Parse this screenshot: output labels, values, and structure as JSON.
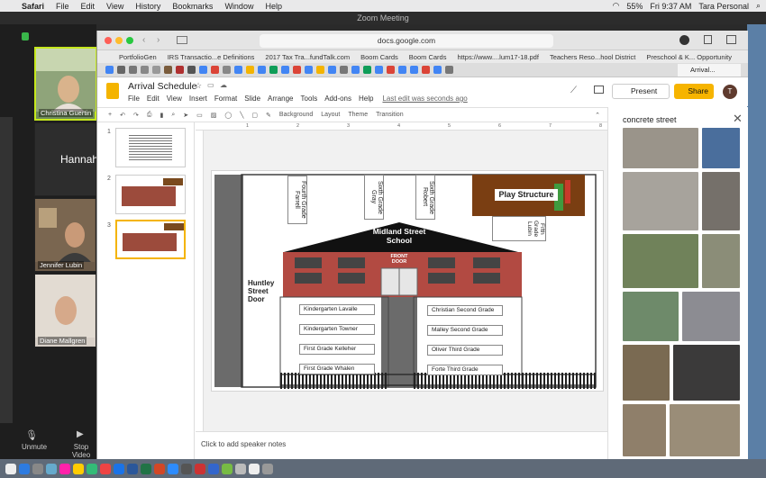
{
  "mac_menubar": {
    "app": "Safari",
    "items": [
      "File",
      "Edit",
      "View",
      "History",
      "Bookmarks",
      "Window",
      "Help"
    ],
    "battery": "55%",
    "clock": "Fri 9:37 AM",
    "user": "Tara Personal"
  },
  "zoom": {
    "window_title": "Zoom Meeting",
    "participants": [
      {
        "name": "Christina Guertin"
      },
      {
        "name": "Hannah"
      },
      {
        "name": "Jennifer Lubin"
      },
      {
        "name": "Diane Mallgren"
      }
    ],
    "unmute_label": "Unmute",
    "stop_video_label": "Stop Video"
  },
  "browser": {
    "url": "docs.google.com",
    "bookmarks": [
      "PortfolioGen",
      "IRS Transactio...e Definitions",
      "2017 Tax Tra...fundTalk.com",
      "Boom Cards",
      "Boom Cards",
      "https://www....lum17-18.pdf",
      "Teachers Reso...hool District",
      "Preschool & K... Opportunity"
    ],
    "active_tab": "Arrival..."
  },
  "docs": {
    "title": "Arrival Schedule",
    "menu": [
      "File",
      "Edit",
      "View",
      "Insert",
      "Format",
      "Slide",
      "Arrange",
      "Tools",
      "Add-ons",
      "Help"
    ],
    "last_edit": "Last edit was seconds ago",
    "present_label": "Present",
    "share_label": "Share",
    "avatar_letter": "T",
    "toolbar": {
      "background": "Background",
      "layout": "Layout",
      "theme": "Theme",
      "transition": "Transition"
    },
    "slide_numbers": [
      "1",
      "2",
      "3"
    ],
    "notes_placeholder": "Click to add speaker notes",
    "ruler_ticks": [
      "1",
      "2",
      "3",
      "4",
      "5",
      "6",
      "7",
      "8",
      "9"
    ]
  },
  "slide": {
    "building_title_line1": "Midland Street",
    "building_title_line2": "School",
    "front_door_line1": "FRONT",
    "front_door_line2": "DOOR",
    "side_door_line1": "Huntley",
    "side_door_line2": "Street",
    "side_door_line3": "Door",
    "play_structure": "Play Structure",
    "top_labels": [
      {
        "grade": "Fourth Grade",
        "teacher": "Farrell"
      },
      {
        "grade": "Sixth Grade",
        "teacher": "Gray"
      },
      {
        "grade": "Sixth Grade",
        "teacher": "Robert"
      },
      {
        "grade": "Fifth Grade",
        "teacher": "Lubin"
      }
    ],
    "left_rows": [
      {
        "grade": "Kindergarten",
        "teacher": "Lavalle"
      },
      {
        "grade": "Kindergarten",
        "teacher": "Towner"
      },
      {
        "grade": "First Grade",
        "teacher": "Kelleher"
      },
      {
        "grade": "First Grade",
        "teacher": "Whalen"
      }
    ],
    "right_rows": [
      {
        "teacher": "Christian",
        "grade": "Second Grade"
      },
      {
        "teacher": "Malley",
        "grade": "Second Grade"
      },
      {
        "teacher": "Oliver",
        "grade": "Third Grade"
      },
      {
        "teacher": "Forte",
        "grade": "Third Grade"
      }
    ]
  },
  "explore_panel": {
    "search_query": "concrete street"
  }
}
